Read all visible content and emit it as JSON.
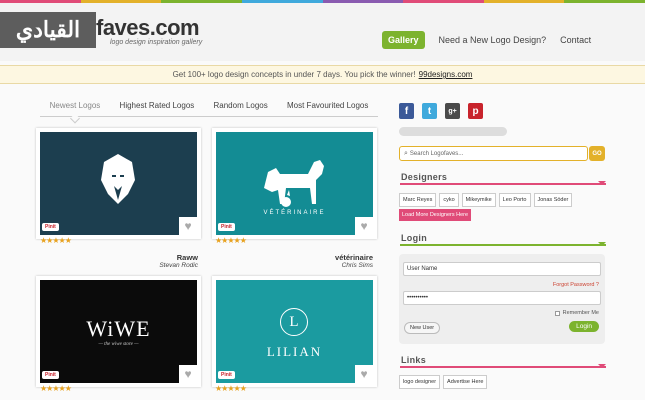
{
  "header": {
    "badge_text": "القيادي",
    "logo_text": "faves.com",
    "tagline": "logo design inspiration gallery",
    "nav": [
      {
        "label": "Gallery",
        "active": true
      },
      {
        "label": "Need a New Logo Design?",
        "active": false
      },
      {
        "label": "Contact",
        "active": false
      }
    ]
  },
  "banner": {
    "text": "Get 100+ logo design concepts in under 7 days. You pick the winner!",
    "link": "99designs.com"
  },
  "tabs": [
    "Newest Logos",
    "Highest Rated Logos",
    "Random Logos",
    "Most Favourited Logos"
  ],
  "logos": [
    {
      "title": "Raww",
      "author": "Stevan Rodic",
      "bg": "#1c3e4f",
      "stars": "★★★★★",
      "pin": "Pinit",
      "caption": ""
    },
    {
      "title": "vétérinaire",
      "author": "Chris Sims",
      "bg": "#138c94",
      "stars": "★★★★★",
      "pin": "Pinit",
      "caption": "VÉTÉRINAIRE"
    },
    {
      "title": "",
      "author": "",
      "bg": "#0b0b0b",
      "stars": "★★★★★",
      "pin": "Pinit",
      "caption": "WiWE",
      "subcaption": "— the wiwe store —"
    },
    {
      "title": "",
      "author": "",
      "bg": "#1b9ba0",
      "stars": "★★★★★",
      "pin": "Pinit",
      "caption": "LILIAN",
      "monogram": "L"
    }
  ],
  "social": [
    {
      "icon": "facebook-icon",
      "glyph": "f",
      "color": "#3b5998"
    },
    {
      "icon": "twitter-icon",
      "glyph": "t",
      "color": "#3fa9dc"
    },
    {
      "icon": "googleplus-icon",
      "glyph": "g+",
      "color": "#4a4a4a"
    },
    {
      "icon": "pinterest-icon",
      "glyph": "p",
      "color": "#c8232c"
    }
  ],
  "search": {
    "placeholder": "Search Logofaves...",
    "go": "GO"
  },
  "designers": {
    "title": "Designers",
    "names": [
      "Marc Reyes",
      "cyko",
      "Mikeymike",
      "Leo Porto",
      "Jonas Söder"
    ],
    "load_more": "Load More Designers Here"
  },
  "login": {
    "title": "Login",
    "username_placeholder": "User Name",
    "password_value": "••••••••••",
    "forgot": "Forgot Password ?",
    "remember": "Remember Me",
    "new_user": "New User",
    "login_btn": "Login"
  },
  "links": {
    "title": "Links",
    "items": [
      "logo designer",
      "Advertise Here"
    ]
  },
  "colors": {
    "accent_green": "#7cb32e",
    "accent_yellow": "#e3b12a",
    "accent_pink": "#e04b78"
  }
}
